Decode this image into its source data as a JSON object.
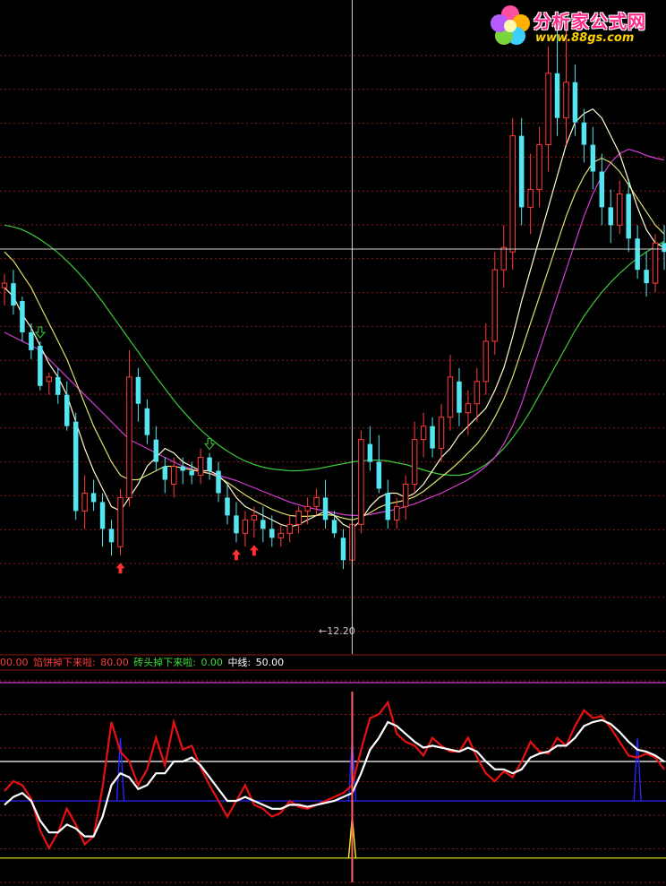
{
  "logo": {
    "title": "分析家公式网",
    "url": "www.88gs.com"
  },
  "colors": {
    "up": "#ff3b3b",
    "down": "#53e6f0",
    "ma_short": "#fffbd0",
    "ma_mid": "#e0e070",
    "ma_purple": "#d43cd4",
    "ma_green": "#3cc83c",
    "grid": "#8b1a1a",
    "indicator_red": "#e81010",
    "indicator_white": "#ffffff",
    "indicator_blue": "#2525ff",
    "indicator_yellow": "#f0f020",
    "line_magenta": "#d43cd4"
  },
  "legend": {
    "item1_value": "00.00",
    "item2_label": "馅饼掉下来啦:",
    "item2_value": "80.00",
    "item3_label": "砖头掉下来啦:",
    "item3_value": "0.00",
    "item4_label": "中线:",
    "item4_value": "50.00"
  },
  "chart_data": [
    {
      "type": "candlestick",
      "low_label": "12.20",
      "ylim": [
        12.0,
        19.0
      ],
      "candles": [
        [
          15.9,
          16.05,
          15.7,
          15.95
        ],
        [
          15.95,
          16.1,
          15.6,
          15.7
        ],
        [
          15.75,
          15.8,
          15.3,
          15.4
        ],
        [
          15.4,
          15.5,
          15.1,
          15.2
        ],
        [
          15.25,
          15.3,
          14.75,
          14.8
        ],
        [
          14.85,
          14.95,
          14.7,
          14.9
        ],
        [
          14.9,
          15.0,
          14.6,
          14.7
        ],
        [
          14.7,
          14.85,
          14.3,
          14.35
        ],
        [
          14.4,
          14.5,
          13.3,
          13.4
        ],
        [
          13.4,
          13.8,
          13.2,
          13.6
        ],
        [
          13.6,
          13.75,
          13.4,
          13.5
        ],
        [
          13.5,
          13.6,
          13.0,
          13.2
        ],
        [
          13.2,
          13.3,
          12.9,
          13.05
        ],
        [
          13.0,
          13.65,
          12.9,
          13.55
        ],
        [
          13.55,
          15.2,
          13.45,
          14.9
        ],
        [
          14.9,
          15.0,
          14.4,
          14.6
        ],
        [
          14.55,
          14.65,
          14.15,
          14.25
        ],
        [
          14.2,
          14.35,
          13.85,
          13.95
        ],
        [
          13.9,
          14.0,
          13.6,
          13.75
        ],
        [
          13.7,
          14.0,
          13.55,
          13.9
        ],
        [
          13.9,
          14.0,
          13.7,
          13.85
        ],
        [
          13.85,
          13.95,
          13.7,
          13.8
        ],
        [
          13.8,
          14.1,
          13.7,
          14.0
        ],
        [
          14.0,
          14.05,
          13.75,
          13.85
        ],
        [
          13.85,
          13.95,
          13.5,
          13.6
        ],
        [
          13.55,
          13.7,
          13.25,
          13.35
        ],
        [
          13.35,
          13.5,
          13.05,
          13.15
        ],
        [
          13.15,
          13.4,
          13.0,
          13.3
        ],
        [
          13.3,
          13.45,
          13.1,
          13.35
        ],
        [
          13.3,
          13.45,
          13.05,
          13.2
        ],
        [
          13.2,
          13.35,
          13.0,
          13.1
        ],
        [
          13.1,
          13.25,
          13.0,
          13.15
        ],
        [
          13.15,
          13.35,
          13.05,
          13.25
        ],
        [
          13.25,
          13.45,
          13.15,
          13.4
        ],
        [
          13.4,
          13.55,
          13.25,
          13.45
        ],
        [
          13.45,
          13.65,
          13.35,
          13.55
        ],
        [
          13.55,
          13.75,
          13.2,
          13.3
        ],
        [
          13.3,
          13.4,
          13.1,
          13.15
        ],
        [
          13.1,
          13.2,
          12.75,
          12.85
        ],
        [
          12.85,
          13.3,
          12.2,
          13.25
        ],
        [
          13.25,
          14.3,
          13.15,
          14.2
        ],
        [
          14.15,
          14.35,
          13.85,
          13.95
        ],
        [
          13.95,
          14.25,
          13.6,
          13.65
        ],
        [
          13.6,
          13.75,
          13.2,
          13.3
        ],
        [
          13.3,
          13.55,
          13.2,
          13.45
        ],
        [
          13.45,
          13.8,
          13.3,
          13.7
        ],
        [
          13.7,
          14.4,
          13.6,
          14.2
        ],
        [
          14.2,
          14.5,
          14.0,
          14.35
        ],
        [
          14.35,
          14.45,
          14.0,
          14.1
        ],
        [
          14.1,
          14.6,
          13.95,
          14.45
        ],
        [
          14.45,
          15.15,
          14.3,
          14.9
        ],
        [
          14.85,
          15.0,
          14.35,
          14.5
        ],
        [
          14.5,
          14.75,
          14.25,
          14.6
        ],
        [
          14.6,
          15.0,
          14.4,
          14.85
        ],
        [
          14.85,
          15.5,
          14.7,
          15.3
        ],
        [
          15.3,
          16.3,
          15.15,
          16.1
        ],
        [
          16.1,
          16.6,
          15.9,
          16.35
        ],
        [
          16.3,
          17.8,
          16.1,
          17.6
        ],
        [
          17.6,
          17.8,
          16.6,
          16.8
        ],
        [
          16.8,
          17.4,
          16.5,
          17.0
        ],
        [
          17.0,
          17.7,
          16.8,
          17.5
        ],
        [
          17.5,
          18.6,
          17.2,
          18.3
        ],
        [
          18.3,
          18.9,
          17.6,
          17.8
        ],
        [
          17.8,
          18.8,
          17.5,
          18.2
        ],
        [
          18.2,
          18.4,
          17.6,
          17.75
        ],
        [
          17.75,
          17.9,
          17.3,
          17.5
        ],
        [
          17.5,
          17.7,
          17.0,
          17.2
        ],
        [
          17.2,
          17.4,
          16.6,
          16.8
        ],
        [
          16.8,
          17.0,
          16.4,
          16.6
        ],
        [
          16.6,
          17.1,
          16.5,
          16.95
        ],
        [
          16.95,
          17.1,
          16.3,
          16.45
        ],
        [
          16.45,
          16.6,
          16.0,
          16.1
        ],
        [
          16.1,
          16.3,
          15.8,
          15.95
        ],
        [
          15.95,
          16.5,
          15.85,
          16.4
        ],
        [
          16.4,
          16.6,
          16.1,
          16.3
        ]
      ],
      "moving_averages": {
        "ma_short": [
          15.9,
          15.8,
          15.6,
          15.45,
          15.25,
          15.05,
          14.9,
          14.7,
          14.4,
          14.1,
          13.85,
          13.65,
          13.45,
          13.4,
          13.55,
          13.7,
          13.9,
          14.0,
          14.1,
          14.05,
          13.95,
          13.9,
          13.85,
          13.85,
          13.8,
          13.7,
          13.55,
          13.45,
          13.4,
          13.35,
          13.3,
          13.25,
          13.22,
          13.25,
          13.3,
          13.35,
          13.4,
          13.35,
          13.25,
          13.2,
          13.3,
          13.45,
          13.55,
          13.6,
          13.6,
          13.55,
          13.6,
          13.7,
          13.85,
          14.0,
          14.1,
          14.25,
          14.35,
          14.45,
          14.55,
          14.75,
          15.0,
          15.35,
          15.75,
          16.1,
          16.45,
          16.8,
          17.15,
          17.5,
          17.75,
          17.85,
          17.9,
          17.8,
          17.6,
          17.4,
          17.1,
          16.8,
          16.55,
          16.4,
          16.35
        ],
        "ma_mid": [
          16.3,
          16.2,
          16.05,
          15.9,
          15.7,
          15.5,
          15.3,
          15.1,
          14.85,
          14.6,
          14.35,
          14.15,
          13.95,
          13.8,
          13.75,
          13.75,
          13.8,
          13.85,
          13.9,
          13.9,
          13.88,
          13.86,
          13.84,
          13.82,
          13.78,
          13.72,
          13.65,
          13.58,
          13.52,
          13.47,
          13.42,
          13.38,
          13.35,
          13.34,
          13.34,
          13.35,
          13.36,
          13.35,
          13.32,
          13.3,
          13.33,
          13.38,
          13.44,
          13.48,
          13.5,
          13.52,
          13.56,
          13.62,
          13.7,
          13.78,
          13.86,
          13.95,
          14.05,
          14.15,
          14.28,
          14.45,
          14.65,
          14.9,
          15.2,
          15.5,
          15.8,
          16.1,
          16.4,
          16.7,
          16.95,
          17.15,
          17.3,
          17.35,
          17.3,
          17.2,
          17.05,
          16.9,
          16.75,
          16.6,
          16.5
        ],
        "ma_purple": [
          15.4,
          15.35,
          15.3,
          15.25,
          15.2,
          15.1,
          15.0,
          14.9,
          14.8,
          14.7,
          14.6,
          14.5,
          14.4,
          14.3,
          14.2,
          14.15,
          14.1,
          14.05,
          14.0,
          13.95,
          13.9,
          13.87,
          13.84,
          13.82,
          13.8,
          13.77,
          13.74,
          13.7,
          13.66,
          13.62,
          13.58,
          13.54,
          13.5,
          13.47,
          13.44,
          13.42,
          13.4,
          13.38,
          13.36,
          13.35,
          13.35,
          13.36,
          13.38,
          13.4,
          13.42,
          13.45,
          13.48,
          13.52,
          13.56,
          13.6,
          13.65,
          13.7,
          13.75,
          13.82,
          13.9,
          14.0,
          14.15,
          14.35,
          14.6,
          14.9,
          15.2,
          15.5,
          15.8,
          16.1,
          16.4,
          16.7,
          16.95,
          17.15,
          17.3,
          17.4,
          17.45,
          17.42,
          17.38,
          17.35,
          17.33
        ],
        "ma_green": [
          16.6,
          16.58,
          16.55,
          16.5,
          16.44,
          16.37,
          16.29,
          16.2,
          16.1,
          15.99,
          15.87,
          15.74,
          15.6,
          15.46,
          15.32,
          15.18,
          15.04,
          14.9,
          14.77,
          14.64,
          14.52,
          14.41,
          14.31,
          14.22,
          14.14,
          14.07,
          14.01,
          13.96,
          13.92,
          13.89,
          13.87,
          13.86,
          13.85,
          13.85,
          13.86,
          13.87,
          13.89,
          13.91,
          13.93,
          13.95,
          13.96,
          13.97,
          13.97,
          13.96,
          13.94,
          13.92,
          13.89,
          13.86,
          13.83,
          13.81,
          13.8,
          13.8,
          13.82,
          13.86,
          13.92,
          14.0,
          14.1,
          14.22,
          14.36,
          14.52,
          14.7,
          14.88,
          15.06,
          15.24,
          15.42,
          15.58,
          15.72,
          15.85,
          15.96,
          16.06,
          16.15,
          16.23,
          16.3,
          16.36,
          16.42
        ]
      },
      "signals": [
        {
          "type": "arrow-up",
          "color": "#ff3030",
          "index": 13
        },
        {
          "type": "arrow-up",
          "color": "#ff3030",
          "index": 26
        },
        {
          "type": "arrow-up",
          "color": "#ff3030",
          "index": 28
        },
        {
          "type": "arrow-down",
          "color": "#3cc83c",
          "index": 4
        },
        {
          "type": "arrow-down",
          "color": "#3cc83c",
          "index": 23
        },
        {
          "type": "arrow-down",
          "color": "#3cc83c",
          "index": 63
        }
      ]
    },
    {
      "type": "line",
      "ylim": [
        0,
        100
      ],
      "reference_lines": [
        {
          "value": 90,
          "color": "#d43cd4"
        },
        {
          "value": 50,
          "color": "#ffffff"
        },
        {
          "value": 80,
          "color": "#e81010"
        },
        {
          "value": 30,
          "color": "#2525ff"
        },
        {
          "value": 1,
          "color": "#f0f020"
        }
      ],
      "series": [
        {
          "color": "#e81010",
          "values": [
            35,
            40,
            38,
            31,
            15,
            6,
            14,
            26,
            18,
            8,
            12,
            37,
            70,
            55,
            50,
            38,
            46,
            62,
            48,
            70,
            56,
            58,
            47,
            38,
            30,
            22,
            30,
            38,
            28,
            26,
            22,
            24,
            30,
            27,
            26,
            28,
            30,
            32,
            34,
            38,
            56,
            72,
            74,
            80,
            64,
            60,
            58,
            53,
            62,
            58,
            55,
            55,
            62,
            52,
            44,
            40,
            45,
            42,
            50,
            60,
            55,
            54,
            62,
            58,
            68,
            76,
            72,
            73,
            67,
            60,
            53,
            52,
            54,
            52,
            46
          ]
        },
        {
          "color": "#ffffff",
          "values": [
            28,
            32,
            34,
            30,
            20,
            14,
            14,
            18,
            16,
            12,
            12,
            22,
            38,
            44,
            42,
            36,
            38,
            44,
            44,
            50,
            50,
            52,
            48,
            42,
            36,
            30,
            30,
            32,
            30,
            28,
            26,
            26,
            28,
            28,
            27,
            28,
            29,
            30,
            32,
            34,
            44,
            56,
            62,
            70,
            68,
            64,
            60,
            57,
            58,
            57,
            56,
            55,
            57,
            55,
            50,
            46,
            46,
            44,
            46,
            52,
            54,
            55,
            58,
            58,
            62,
            68,
            70,
            71,
            69,
            65,
            60,
            56,
            55,
            53,
            50
          ]
        }
      ]
    }
  ]
}
